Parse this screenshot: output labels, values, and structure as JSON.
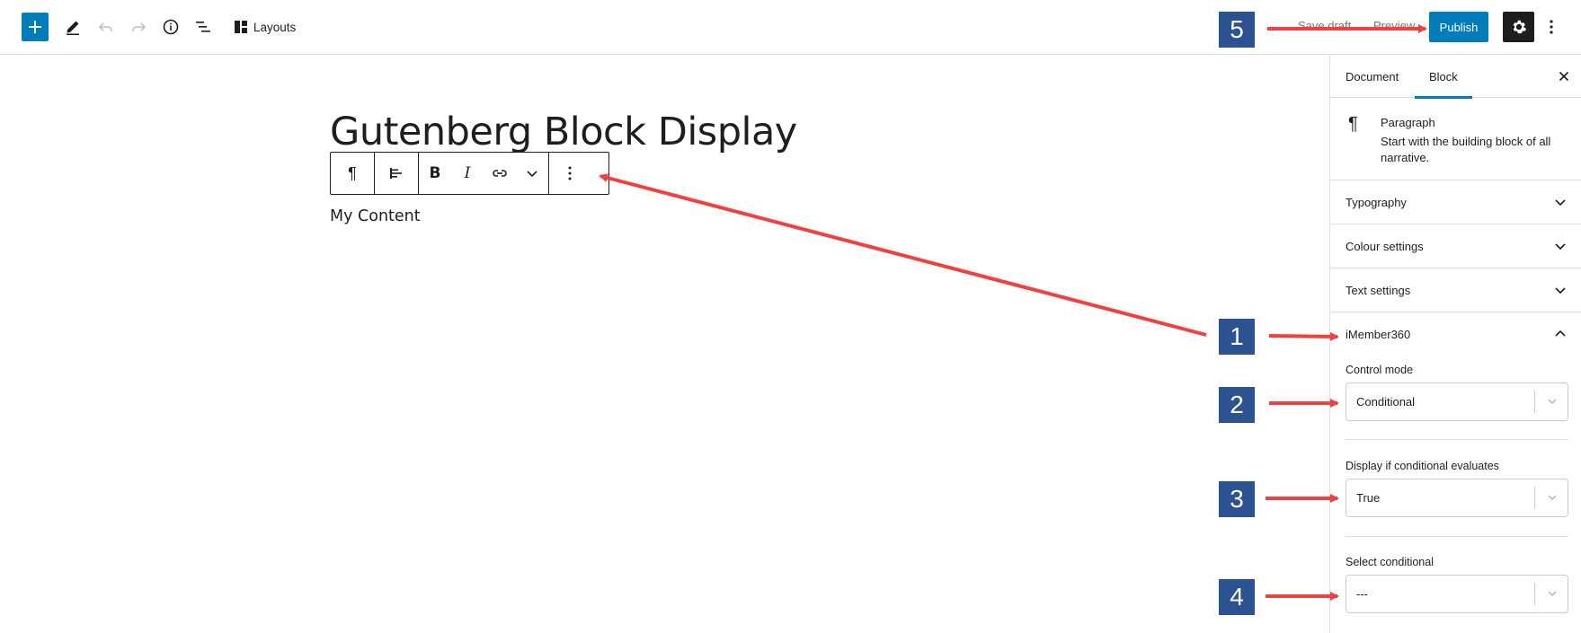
{
  "toolbar": {
    "add_icon": "plus-icon",
    "edit_icon": "pencil-icon",
    "undo_icon": "undo-icon",
    "redo_icon": "redo-icon",
    "info_icon": "info-icon",
    "outline_icon": "list-view-icon",
    "layouts_label": "Layouts",
    "save_draft_label": "Save draft",
    "preview_label": "Preview",
    "publish_label": "Publish",
    "settings_icon": "gear-icon",
    "more_icon": "vertical-ellipsis-icon",
    "colors": {
      "accent": "#007cba",
      "dark": "#1e1e1e"
    }
  },
  "editor": {
    "title": "Gutenberg Block Display",
    "content": "My Content",
    "block_toolbar": {
      "paragraph_icon": "¶",
      "align_icon": "align-left-icon",
      "bold_label": "B",
      "italic_label": "I",
      "link_icon": "link-icon",
      "more_rich_icon": "chevron-down-icon",
      "options_icon": "vertical-ellipsis-icon"
    }
  },
  "sidebar": {
    "tabs": [
      {
        "label": "Document",
        "active": false
      },
      {
        "label": "Block",
        "active": true
      }
    ],
    "close_icon": "close-icon",
    "block_card": {
      "icon": "¶",
      "title": "Paragraph",
      "description": "Start with the building block of all narrative."
    },
    "panels": [
      {
        "label": "Typography",
        "expanded": false
      },
      {
        "label": "Colour settings",
        "expanded": false
      },
      {
        "label": "Text settings",
        "expanded": false
      },
      {
        "label": "iMember360",
        "expanded": true
      }
    ],
    "imember": {
      "control_mode_label": "Control mode",
      "control_mode_value": "Conditional",
      "display_if_label": "Display if conditional evaluates",
      "display_if_value": "True",
      "select_conditional_label": "Select conditional",
      "select_conditional_value": "---"
    }
  },
  "annotations": {
    "badges": [
      "1",
      "2",
      "3",
      "4",
      "5"
    ],
    "arrow_color": "#ef4141",
    "badge_color": "#2d5291"
  }
}
